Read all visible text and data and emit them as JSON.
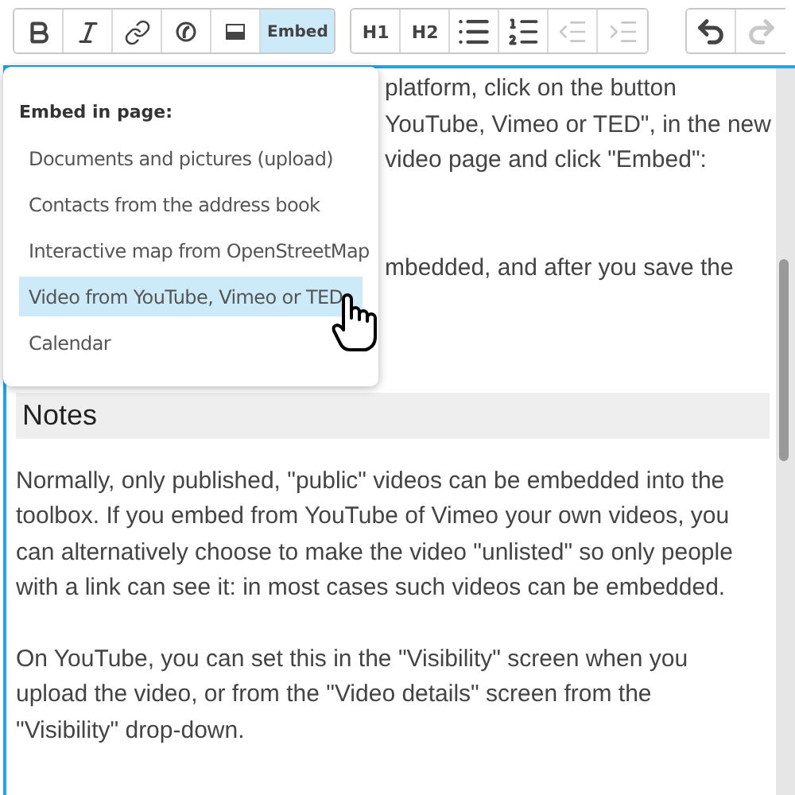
{
  "toolbar": {
    "groups": [
      {
        "buttons": [
          {
            "kind": "bold",
            "selected": false,
            "disabled": false
          },
          {
            "kind": "italic",
            "selected": false,
            "disabled": false
          },
          {
            "kind": "link",
            "selected": false,
            "disabled": false
          },
          {
            "kind": "circle-c",
            "selected": false,
            "disabled": false
          },
          {
            "kind": "image",
            "selected": false,
            "disabled": false
          },
          {
            "kind": "text",
            "label": "Embed",
            "selected": true,
            "disabled": false
          }
        ]
      },
      {
        "buttons": [
          {
            "kind": "text",
            "label": "H1",
            "selected": false,
            "disabled": false
          },
          {
            "kind": "text",
            "label": "H2",
            "selected": false,
            "disabled": false
          },
          {
            "kind": "bullets",
            "selected": false,
            "disabled": false
          },
          {
            "kind": "numbered",
            "selected": false,
            "disabled": false
          },
          {
            "kind": "outdent",
            "selected": false,
            "disabled": true
          },
          {
            "kind": "indent",
            "selected": false,
            "disabled": true
          }
        ]
      },
      {
        "buttons": [
          {
            "kind": "undo",
            "selected": false,
            "disabled": false
          },
          {
            "kind": "redo",
            "selected": false,
            "disabled": true
          }
        ]
      }
    ]
  },
  "embed_menu": {
    "heading": "Embed in page:",
    "items": [
      {
        "label": "Documents and pictures (upload)",
        "selected": false
      },
      {
        "label": "Contacts from the address book",
        "selected": false
      },
      {
        "label": "Interactive map from OpenStreetMap",
        "selected": false
      },
      {
        "label": "Video from YouTube, Vimeo or TED",
        "selected": true
      },
      {
        "label": "Calendar",
        "selected": false
      }
    ]
  },
  "editor": {
    "hidden_lines": [
      {
        "text": "platform, click on the button"
      },
      {
        "text": "YouTube, Vimeo or TED\", in the new"
      },
      {
        "text": "video page and click \"Embed\":"
      },
      {
        "text": "mbedded, and after you save the"
      }
    ],
    "heading": "Notes",
    "paragraphs": [
      "Normally, only published, \"public\" videos can be embedded into the toolbox. If you embed from YouTube of Vimeo your own videos, you can alternatively choose to make the video \"unlisted\" so only people with a link can see it: in most cases such videos can be embedded.",
      "On YouTube, you can set this in the \"Visibility\" screen when you upload the video, or from the \"Video details\" screen from the \"Visibility\" drop-down."
    ]
  }
}
